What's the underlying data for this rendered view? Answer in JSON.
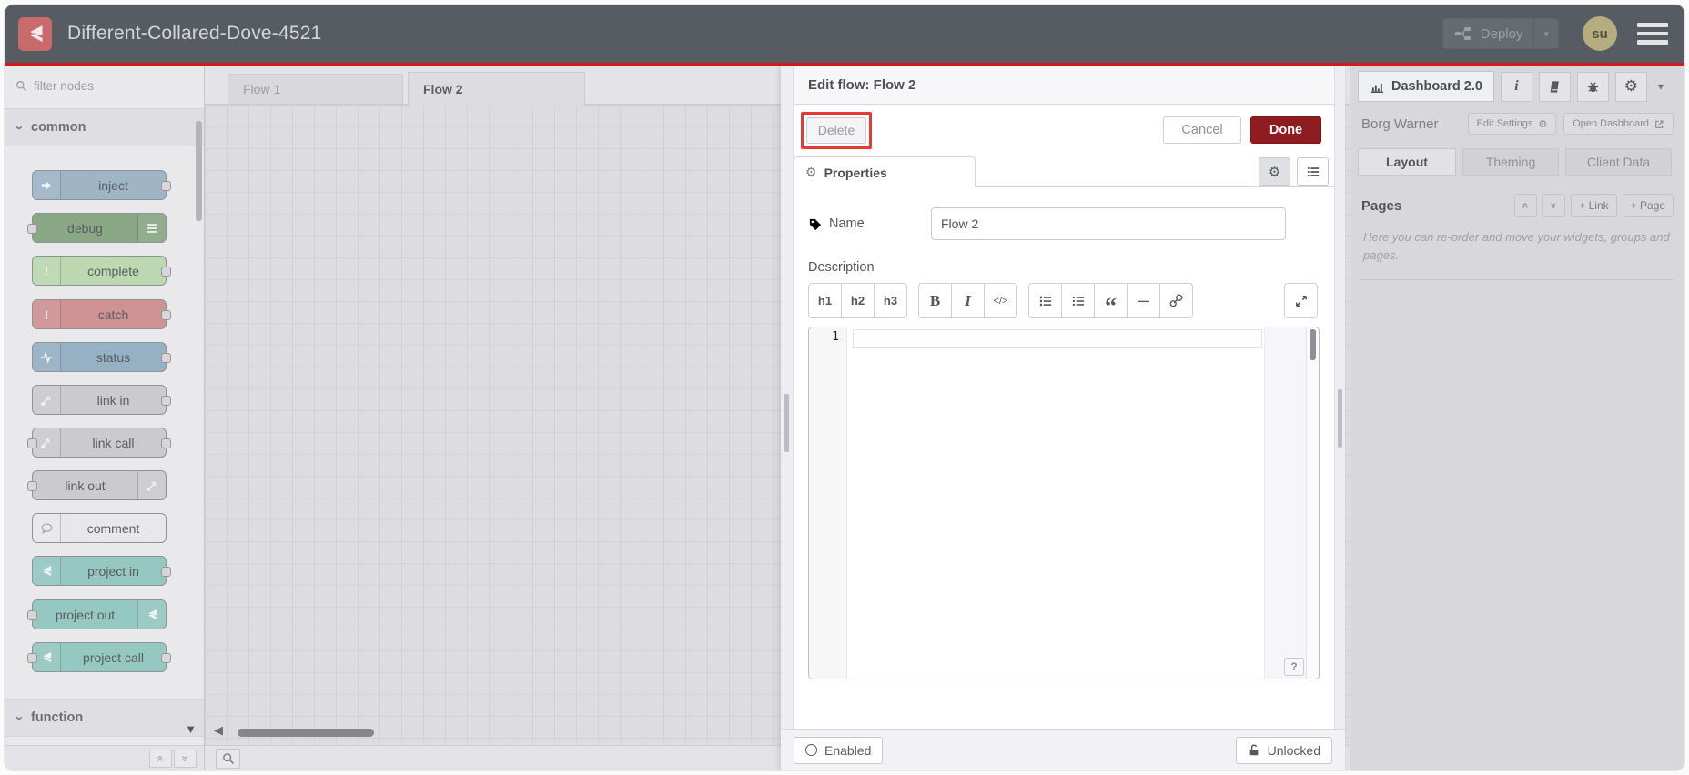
{
  "header": {
    "title": "Different-Collared-Dove-4521",
    "deploy_label": "Deploy",
    "avatar_initials": "su"
  },
  "palette": {
    "filter_placeholder": "filter nodes",
    "categories": [
      {
        "label": "common",
        "expanded": true,
        "nodes": [
          {
            "label": "inject",
            "color": "#9fb5c6"
          },
          {
            "label": "debug",
            "color": "#8ba886"
          },
          {
            "label": "complete",
            "color": "#bcd9b2"
          },
          {
            "label": "catch",
            "color": "#d09394"
          },
          {
            "label": "status",
            "color": "#97b1c4"
          },
          {
            "label": "link in",
            "color": "#cbcbcf"
          },
          {
            "label": "link call",
            "color": "#cbcbcf"
          },
          {
            "label": "link out",
            "color": "#cbcbcf"
          },
          {
            "label": "comment",
            "color": "#e8e8eb"
          },
          {
            "label": "project in",
            "color": "#95c8c1"
          },
          {
            "label": "project out",
            "color": "#95c8c1"
          },
          {
            "label": "project call",
            "color": "#95c8c1"
          }
        ]
      },
      {
        "label": "function",
        "expanded": false,
        "nodes": []
      }
    ]
  },
  "workspace": {
    "tabs": [
      {
        "label": "Flow 1",
        "active": false
      },
      {
        "label": "Flow 2",
        "active": true
      }
    ]
  },
  "tray": {
    "title": "Edit flow: Flow 2",
    "delete_label": "Delete",
    "cancel_label": "Cancel",
    "done_label": "Done",
    "properties_tab_label": "Properties",
    "name_label": "Name",
    "name_value": "Flow 2",
    "description_label": "Description",
    "toolbar": {
      "h1": "h1",
      "h2": "h2",
      "h3": "h3",
      "bold": "B",
      "italic": "I",
      "code": "</>"
    },
    "editor": {
      "line_number": "1",
      "help_label": "?"
    },
    "footer": {
      "enabled_label": "Enabled",
      "lock_label": "Unlocked"
    }
  },
  "sidebar": {
    "tab_label": "Dashboard 2.0",
    "project_name": "Borg Warner",
    "edit_settings_label": "Edit Settings",
    "open_dashboard_label": "Open Dashboard",
    "tabs": [
      {
        "label": "Layout",
        "active": true
      },
      {
        "label": "Theming",
        "active": false
      },
      {
        "label": "Client Data",
        "active": false
      }
    ],
    "pages": {
      "heading": "Pages",
      "link_button": "+ Link",
      "page_button": "+ Page",
      "help_text": "Here you can re-order and move your widgets, groups and pages."
    }
  },
  "icons": {
    "gear": "⚙",
    "caret_down": "▾",
    "chevron": "›",
    "scroll_up": "«",
    "scroll_down": "»",
    "triangle_down": "▼",
    "triangle_left": "◀",
    "quote": "“",
    "hr": "—",
    "exclamation": "!",
    "info": "i"
  },
  "colors": {
    "header_bg": "#575c63",
    "accent_red_line": "#d61a1a",
    "logo_red": "#c96a6c",
    "done_button_red": "#8e1c20",
    "annotation_red": "#e53935",
    "avatar_bg": "#b5ad7f",
    "tray_bg": "#ffffff",
    "sidebar_bg": "#d8d8dc",
    "canvas_bg": "#dcdce1"
  }
}
